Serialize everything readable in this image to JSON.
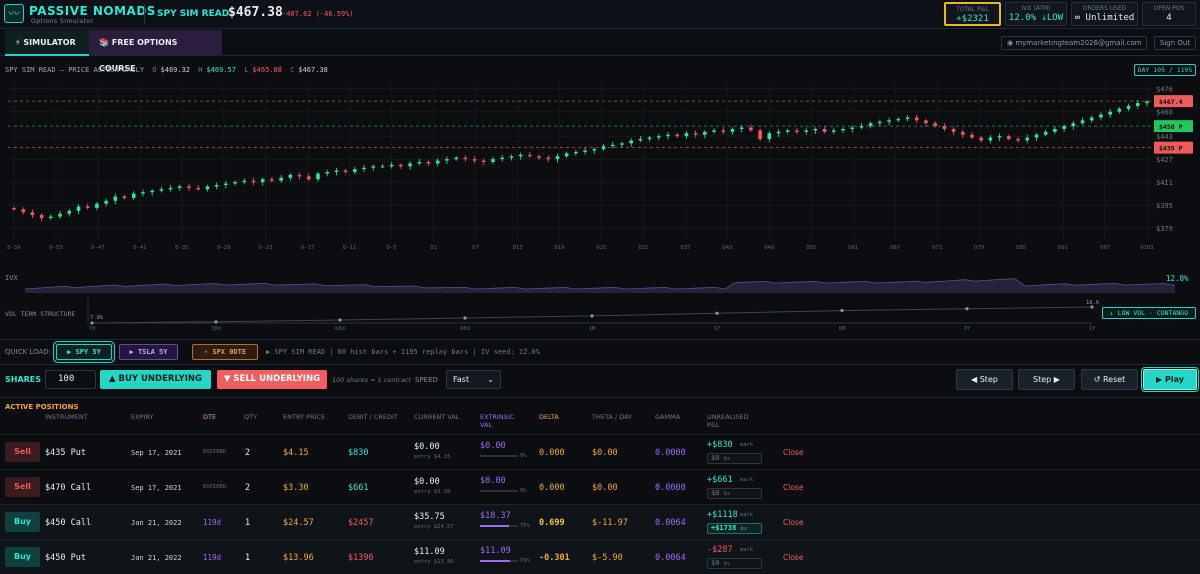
{
  "header": {
    "brand": "PASSIVE NOMADS",
    "brand_sub": "Options Simulator",
    "ticker_label": "SPY SIM READ",
    "price": "$467.38",
    "change": "-407.62 (-46.59%)",
    "stats": [
      {
        "label": "TOTAL P&L",
        "value": "+$2321",
        "color": "#2ee6d3"
      },
      {
        "label": "IVX (ATM)",
        "value": "12.0% ↓LOW",
        "color": "#2ee6d3"
      },
      {
        "label": "ORDERS USED",
        "value": "∞ Unlimited",
        "color": "#e6edf3"
      },
      {
        "label": "OPEN POS",
        "value": "4",
        "color": "#e6edf3"
      }
    ]
  },
  "tabs": {
    "simulator": "⚡ SIMULATOR",
    "course": "📚 FREE OPTIONS COURSE"
  },
  "account": {
    "email": "mymarketingteam2026@gmail.com",
    "sign_out": "Sign Out"
  },
  "chart_header": {
    "title": "SPY SIM READ — PRICE ACTION DAILY",
    "o_label": "O",
    "o": "$469.32",
    "h_label": "H",
    "h": "$469.57",
    "l_label": "L",
    "l": "$465.88",
    "c_label": "C",
    "c": "$467.38",
    "day_counter": "DAY 105 / 1195"
  },
  "chart_data": {
    "type": "candlestick",
    "y_ticks": [
      "$476",
      "$460",
      "$443",
      "$427",
      "$411",
      "$395",
      "$379"
    ],
    "ylim": [
      370,
      480
    ],
    "x_ticks": [
      "D-59",
      "D-53",
      "D-47",
      "D-41",
      "D-35",
      "D-29",
      "D-23",
      "D-17",
      "D-11",
      "D-5",
      "D1",
      "D7",
      "D13",
      "D19",
      "D25",
      "D31",
      "D37",
      "D43",
      "D49",
      "D55",
      "D61",
      "D67",
      "D73",
      "D79",
      "D85",
      "D91",
      "D97",
      "D103"
    ],
    "close": [
      392,
      390,
      388,
      386,
      387,
      389,
      391,
      394,
      393,
      396,
      398,
      401,
      400,
      403,
      404,
      405,
      406,
      407,
      408,
      407,
      406,
      408,
      409,
      410,
      411,
      412,
      411,
      413,
      412,
      414,
      416,
      415,
      413,
      417,
      418,
      419,
      418,
      420,
      421,
      422,
      422,
      423,
      422,
      424,
      425,
      424,
      426,
      427,
      428,
      427,
      426,
      425,
      427,
      428,
      429,
      430,
      429,
      428,
      427,
      429,
      431,
      432,
      433,
      434,
      436,
      437,
      438,
      440,
      441,
      442,
      443,
      444,
      443,
      445,
      444,
      446,
      447,
      446,
      448,
      449,
      447,
      441,
      445,
      446,
      447,
      446,
      447,
      448,
      446,
      447,
      448,
      449,
      450,
      452,
      453,
      454,
      455,
      456,
      454,
      452,
      450,
      448,
      446,
      444,
      442,
      440,
      442,
      443,
      441,
      440,
      442,
      444,
      446,
      448,
      450,
      452,
      454,
      456,
      458,
      460,
      462,
      464,
      466,
      467
    ],
    "level_lines": [
      {
        "label": "$467.4",
        "value": 467.4,
        "color": "#ef5b5b"
      },
      {
        "label": "$450 P",
        "value": 450,
        "color": "#22c55e"
      },
      {
        "label": "$435 P",
        "value": 435,
        "color": "#ef5b5b"
      }
    ],
    "ivx_label": "IVX",
    "ivx_value": "12.0%",
    "vol_term_label": "VOL TERM STRUCTURE",
    "vol_term_ticks": [
      "7d",
      "30d",
      "60d",
      "90d",
      "1M",
      "1Y",
      "6M",
      "1Y",
      "1Y"
    ],
    "vol_term_points": [
      {
        "label": "7.8%",
        "value": 7.8
      },
      {
        "label": "18.6",
        "value": 18.6
      }
    ],
    "vol_badge": "↓ LOW VOL · CONTANGO"
  },
  "quick_load": {
    "label": "QUICK LOAD:",
    "buttons": [
      "▶ SPY 5Y",
      "▶ TSLA 5Y",
      "⚡ SPX 0DTE"
    ],
    "info": "▶ SPY SIM READ | 60 hist bars + 1195 replay bars | IV seed: 12.0%"
  },
  "controls": {
    "shares_label": "SHARES",
    "shares_value": "100",
    "buy_underlying": "▲ BUY UNDERLYING",
    "sell_underlying": "▼ SELL UNDERLYING",
    "shares_note": "100 shares = 1 contract",
    "speed_label": "SPEED",
    "speed_value": "Fast",
    "step_back": "◀ Step",
    "step_fwd": "Step ▶",
    "reset": "↺ Reset",
    "play": "▶ Play"
  },
  "positions": {
    "title": "ACTIVE POSITIONS",
    "headers": [
      "INSTRUMENT",
      "EXPIRY",
      "DTE",
      "QTY",
      "ENTRY PRICE",
      "DEBIT / CREDIT",
      "CURRENT VAL",
      "EXTRINSIC VAL",
      "DELTA",
      "THETA / DAY",
      "GAMMA",
      "UNREALISED P&L"
    ],
    "rows": [
      {
        "side": "Sell",
        "instrument": "$435 Put",
        "expiry": "Sep 17, 2021",
        "dte": "EXPIRED",
        "qty": "2",
        "entry": "$4.15",
        "debit": "$830",
        "cur": "$0.00",
        "cur_sub": "entry $4.15",
        "ext": "$0.00",
        "ext_pct": "0%",
        "ext_frac": 0,
        "delta": "0.000",
        "theta": "$0.00",
        "gamma": "0.0000",
        "pnl": "+$830",
        "pnl_note": "mark",
        "pnl2": "$0",
        "pnl2_note": "bs",
        "close": "Close"
      },
      {
        "side": "Sell",
        "instrument": "$470 Call",
        "expiry": "Sep 17, 2021",
        "dte": "EXPIRED",
        "qty": "2",
        "entry": "$3.30",
        "debit": "$661",
        "cur": "$0.00",
        "cur_sub": "entry $3.30",
        "ext": "$0.00",
        "ext_pct": "0%",
        "ext_frac": 0,
        "delta": "0.000",
        "theta": "$0.00",
        "gamma": "0.0000",
        "pnl": "+$661",
        "pnl_note": "mark",
        "pnl2": "$0",
        "pnl2_note": "bs",
        "close": "Close"
      },
      {
        "side": "Buy",
        "instrument": "$450 Call",
        "expiry": "Jan 21, 2022",
        "dte": "119d",
        "qty": "1",
        "entry": "$24.57",
        "debit": "$2457",
        "cur": "$35.75",
        "cur_sub": "entry $24.57",
        "ext": "$18.37",
        "ext_pct": "75%",
        "ext_frac": 0.75,
        "delta": "0.699",
        "theta": "$-11.97",
        "gamma": "0.0064",
        "pnl": "+$1118",
        "pnl_note": "mark",
        "pnl2": "+$1738",
        "pnl2_note": "bs",
        "close": "Close"
      },
      {
        "side": "Buy",
        "instrument": "$450 Put",
        "expiry": "Jan 21, 2022",
        "dte": "119d",
        "qty": "1",
        "entry": "$13.96",
        "debit": "$1396",
        "cur": "$11.09",
        "cur_sub": "entry $13.96",
        "ext": "$11.09",
        "ext_pct": "79%",
        "ext_frac": 0.79,
        "delta": "-0.301",
        "theta": "$-5.90",
        "gamma": "0.0064",
        "pnl": "-$287",
        "pnl_note": "mark",
        "pnl2": "$0",
        "pnl2_note": "bs",
        "close": "Close"
      }
    ]
  },
  "colors": {
    "accent": "#22d3c5",
    "up": "#2ee6a0",
    "down": "#ef5b5b",
    "purple": "#9c6cf5",
    "orange": "#f0a73a"
  }
}
